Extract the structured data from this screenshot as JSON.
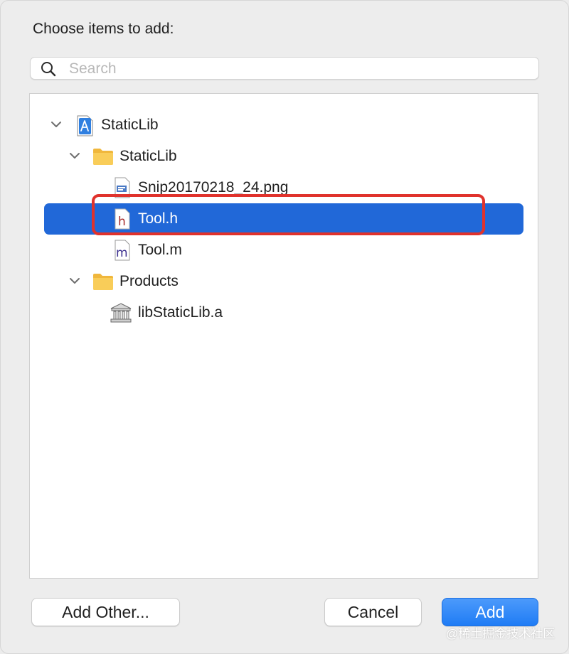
{
  "dialog": {
    "prompt": "Choose items to add:"
  },
  "search": {
    "placeholder": "Search",
    "value": ""
  },
  "tree": {
    "items": [
      {
        "label": "StaticLib",
        "icon": "xcode-project-icon",
        "expanded": true,
        "depth": 0
      },
      {
        "label": "StaticLib",
        "icon": "folder-icon",
        "expanded": true,
        "depth": 1
      },
      {
        "label": "Snip20170218_24.png",
        "icon": "image-file-icon",
        "depth": 2
      },
      {
        "label": "Tool.h",
        "icon": "header-file-icon",
        "depth": 2,
        "selected": true
      },
      {
        "label": "Tool.m",
        "icon": "source-file-icon",
        "depth": 2
      },
      {
        "label": "Products",
        "icon": "folder-icon",
        "expanded": true,
        "depth": 1
      },
      {
        "label": "libStaticLib.a",
        "icon": "library-icon",
        "depth": 2
      }
    ]
  },
  "buttons": {
    "add_other": "Add Other...",
    "cancel": "Cancel",
    "add": "Add"
  },
  "watermark": "@稀土掘金技术社区",
  "colors": {
    "selection": "#2168d8",
    "highlight_box": "#e0322c",
    "primary_button": "#1f7cf5",
    "folder": "#f7c245"
  }
}
